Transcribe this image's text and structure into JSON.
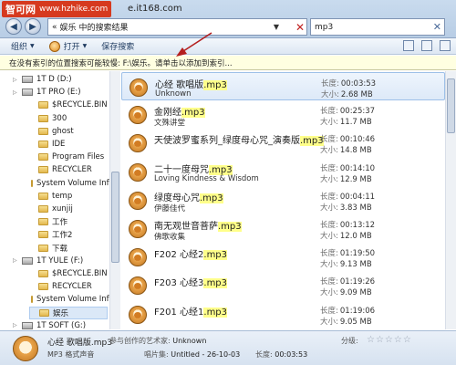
{
  "watermark": {
    "brand": "智可网",
    "url": "www.hzhike.com"
  },
  "site_text": "e.it168.com",
  "address": {
    "segments": [
      "«",
      "娱乐",
      "中的搜索结果"
    ]
  },
  "search": {
    "value": "mp3"
  },
  "toolbar": {
    "organize": "组织",
    "open": "打开",
    "save_search": "保存搜索"
  },
  "infobar": {
    "text": "在没有索引的位置搜索可能较慢: F:\\娱乐。请单击以添加到索引..."
  },
  "nav": {
    "items": [
      {
        "label": "1T D (D:)",
        "type": "drive"
      },
      {
        "label": "1T PRO (E:)",
        "type": "drive"
      },
      {
        "label": "$RECYCLE.BIN",
        "type": "folder"
      },
      {
        "label": "300",
        "type": "folder"
      },
      {
        "label": "ghost",
        "type": "folder"
      },
      {
        "label": "IDE",
        "type": "folder"
      },
      {
        "label": "Program Files",
        "type": "folder"
      },
      {
        "label": "RECYCLER",
        "type": "folder"
      },
      {
        "label": "System Volume Info",
        "type": "folder"
      },
      {
        "label": "temp",
        "type": "folder"
      },
      {
        "label": "xunjij",
        "type": "folder"
      },
      {
        "label": "工作",
        "type": "folder"
      },
      {
        "label": "工作2",
        "type": "folder"
      },
      {
        "label": "下载",
        "type": "folder"
      },
      {
        "label": "1T YULE (F:)",
        "type": "drive"
      },
      {
        "label": "$RECYCLE.BIN",
        "type": "folder"
      },
      {
        "label": "RECYCLER",
        "type": "folder"
      },
      {
        "label": "System Volume Info",
        "type": "folder"
      },
      {
        "label": "娱乐",
        "type": "folder"
      },
      {
        "label": "1T SOFT (G:)",
        "type": "drive"
      }
    ]
  },
  "labels": {
    "length": "长度:",
    "size": "大小:"
  },
  "files": [
    {
      "base": "心经 歌唱版",
      "ext": ".mp3",
      "sub": "Unknown",
      "length": "00:03:53",
      "size": "2.68 MB"
    },
    {
      "base": "金刚经",
      "ext": ".mp3",
      "sub": "文殊讲堂",
      "length": "00:25:37",
      "size": "11.7 MB"
    },
    {
      "base": "天使波罗蜜系列_绿度母心咒_演奏版",
      "ext": ".mp3",
      "sub": "",
      "length": "00:10:46",
      "size": "14.8 MB"
    },
    {
      "base": "二十一度母咒",
      "ext": ".mp3",
      "sub": "Loving Kindness & Wisdom",
      "length": "00:14:10",
      "size": "12.9 MB"
    },
    {
      "base": "绿度母心咒",
      "ext": ".mp3",
      "sub": "伊藤佳代",
      "length": "00:04:11",
      "size": "3.83 MB"
    },
    {
      "base": "南无观世音菩萨",
      "ext": ".mp3",
      "sub": "佛歌收集",
      "length": "00:13:12",
      "size": "12.0 MB"
    },
    {
      "base": "F202 心经2",
      "ext": ".mp3",
      "sub": "",
      "length": "01:19:50",
      "size": "9.13 MB"
    },
    {
      "base": "F203 心经3",
      "ext": ".mp3",
      "sub": "",
      "length": "01:19:26",
      "size": "9.09 MB"
    },
    {
      "base": "F201 心经1",
      "ext": ".mp3",
      "sub": "",
      "length": "01:19:06",
      "size": "9.05 MB"
    }
  ],
  "details": {
    "name": "心经 歌唱版.mp3",
    "type": "MP3 格式声音",
    "artist_label": "参与创作的艺术家:",
    "artist": "Unknown",
    "album_label": "唱片集:",
    "album": "Untitled - 26-10-03",
    "length_label": "长度:",
    "length": "00:03:53",
    "rating_label": "分级:",
    "stars": "☆☆☆☆☆"
  }
}
